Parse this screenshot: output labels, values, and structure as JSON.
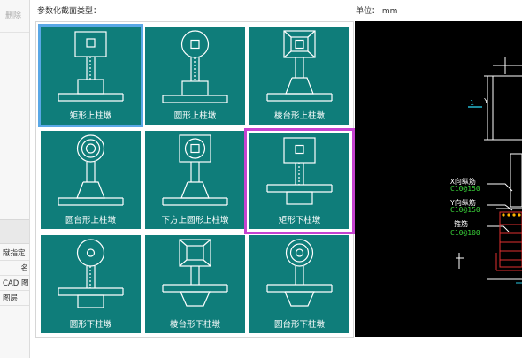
{
  "left_panel": {
    "delete_label": "删除",
    "rows": [
      "蹴指定",
      "名",
      "CAD 图",
      "图层"
    ]
  },
  "header": {
    "param_label": "参数化截面类型：",
    "unit_label": "单位：  mm"
  },
  "tiles": [
    {
      "label": "矩形上柱墩",
      "icon": "rect-upper-pier"
    },
    {
      "label": "圆形上柱墩",
      "icon": "round-upper-pier"
    },
    {
      "label": "棱台形上柱墩",
      "icon": "frustum-upper-pier"
    },
    {
      "label": "圆台形上柱墩",
      "icon": "round-frustum-upper-pier"
    },
    {
      "label": "下方上圆形上柱墩",
      "icon": "square-base-round-top-upper-pier"
    },
    {
      "label": "矩形下柱墩",
      "icon": "rect-lower-pier"
    },
    {
      "label": "圆形下柱墩",
      "icon": "round-lower-pier"
    },
    {
      "label": "棱台形下柱墩",
      "icon": "frustum-lower-pier"
    },
    {
      "label": "圆台形下柱墩",
      "icon": "round-frustum-lower-pier"
    }
  ],
  "selected": {
    "blue": "矩形上柱墩",
    "pink": "矩形下柱墩"
  },
  "cad": {
    "dim_1": "1",
    "dim_y": "Y",
    "x_rebar_label": "X向纵筋",
    "x_rebar_value": "C10@150",
    "y_rebar_label": "Y向纵筋",
    "y_rebar_value": "C10@150",
    "stirrup_label": "箍筋",
    "stirrup_value": "C10@100"
  },
  "colors": {
    "tile_bg": "#0f7d7a",
    "selected_blue": "#5aa8e6",
    "selected_pink": "#c542d0",
    "cad_bg": "#000000",
    "cad_green": "#39d239",
    "cad_red": "#e03030",
    "cad_cyan": "#29c6e0"
  }
}
